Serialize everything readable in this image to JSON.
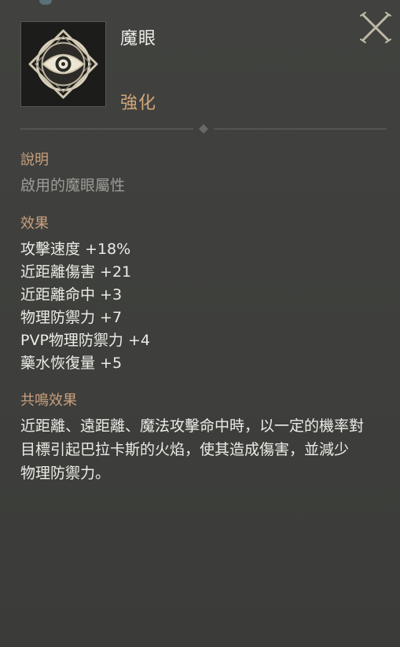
{
  "item": {
    "name": "魔眼",
    "type": "強化",
    "icon": "eye-icon"
  },
  "close": {
    "icon": "close-icon"
  },
  "description": {
    "title": "說明",
    "text": "啟用的魔眼屬性"
  },
  "effects": {
    "title": "效果",
    "lines": [
      "攻擊速度 +18%",
      "近距離傷害 +21",
      "近距離命中 +3",
      "物理防禦力 +7",
      "PVP物理防禦力 +4",
      "藥水恢復量 +5"
    ]
  },
  "resonance": {
    "title": "共鳴效果",
    "lines": [
      "近距離、遠距離、魔法攻擊命中時，以一定的機率對",
      "目標引起巴拉卡斯的火焰，使其造成傷害，並減少",
      "物理防禦力。"
    ]
  },
  "colors": {
    "panel_bg": "#3e3f3c",
    "title_accent": "#c9a07e",
    "type_accent": "#d3a77a",
    "text_primary": "#ecebe6",
    "text_muted": "#9c9c97"
  }
}
